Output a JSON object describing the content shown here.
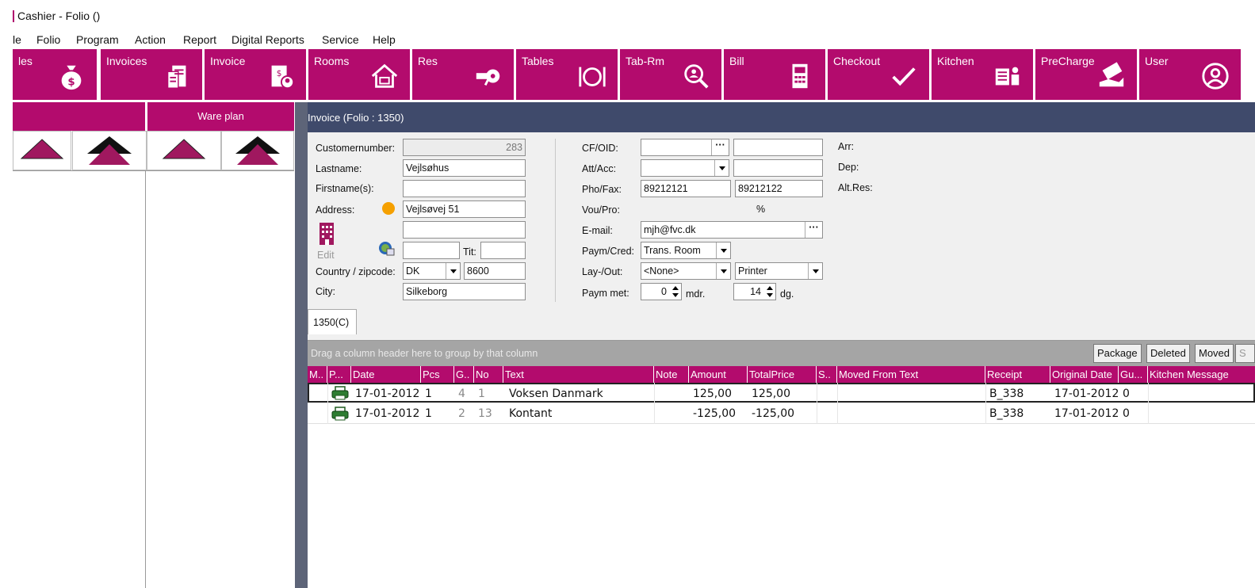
{
  "window": {
    "title": "Cashier - Folio ()"
  },
  "menu": [
    "le",
    "Folio",
    "Program",
    "Action",
    "Report",
    "Digital Reports",
    "Service",
    "Help"
  ],
  "toolbar": [
    {
      "label": "les",
      "icon": "money-bag-icon"
    },
    {
      "label": "Invoices",
      "icon": "invoices-icon"
    },
    {
      "label": "Invoice",
      "icon": "invoice-person-icon"
    },
    {
      "label": "Rooms",
      "icon": "rooms-icon"
    },
    {
      "label": "Res",
      "icon": "key-icon"
    },
    {
      "label": "Tables",
      "icon": "plate-cutlery-icon"
    },
    {
      "label": "Tab-Rm",
      "icon": "search-person-icon"
    },
    {
      "label": "Bill",
      "icon": "cash-register-icon"
    },
    {
      "label": "Checkout",
      "icon": "checkmark-icon"
    },
    {
      "label": "Kitchen",
      "icon": "kitchen-icon"
    },
    {
      "label": "PreCharge",
      "icon": "hand-money-icon"
    },
    {
      "label": "User",
      "icon": "user-icon"
    }
  ],
  "left_panel": {
    "header_left": "",
    "header_right": "Ware plan"
  },
  "invoice": {
    "header": "Invoice (Folio : 1350)",
    "labels": {
      "customernumber": "Customernumber:",
      "lastname": "Lastname:",
      "firstname": "Firstname(s):",
      "address": "Address:",
      "edit": "Edit",
      "tit": "Tit:",
      "country": "Country / zipcode:",
      "city": "City:",
      "cfoid": "CF/OID:",
      "attacc": "Att/Acc:",
      "phofax": "Pho/Fax:",
      "voupro": "Vou/Pro:",
      "email": "E-mail:",
      "paymcred": "Paym/Cred:",
      "layout": "Lay-/Out:",
      "paymmet": "Paym met:",
      "mdr": "mdr.",
      "dg": "dg.",
      "arr": "Arr:",
      "dep": "Dep:",
      "altres": "Alt.Res:",
      "percent": "%"
    },
    "values": {
      "customernumber": "283",
      "lastname": "Vejlsøhus",
      "firstname": "",
      "address": "Vejlsøvej 51",
      "address2": "",
      "extra": "",
      "tit": "",
      "country": "DK",
      "zipcode": "8600",
      "city": "Silkeborg",
      "cfoid": "",
      "cfoid2": "",
      "attacc": "",
      "attacc2": "",
      "phone": "89212121",
      "fax": "89212122",
      "email": "mjh@fvc.dk",
      "paymcred": "Trans. Room",
      "layout": "<None>",
      "out": "Printer",
      "paym_months": "0",
      "paym_days": "14"
    },
    "tab": "1350(C)"
  },
  "grid": {
    "group_hint": "Drag a column header here to group by that column",
    "buttons": [
      "Package",
      "Deleted",
      "Moved",
      "S"
    ],
    "columns": [
      "M..",
      "P...",
      "Date",
      "Pcs",
      "G..",
      "No",
      "Text",
      "Note",
      "Amount",
      "TotalPrice",
      "S..",
      "Moved From Text",
      "Receipt",
      "Original Date",
      "Gu...",
      "Kitchen Message"
    ],
    "rows": [
      {
        "date": "17-01-2012",
        "pcs": "1",
        "g": "4",
        "no": "1",
        "text": "Voksen Danmark",
        "note": "",
        "amount": "125,00",
        "total": "125,00",
        "s": "",
        "moved": "",
        "receipt": "B_338",
        "orig": "17-01-2012",
        "gu": "0",
        "kitchen": ""
      },
      {
        "date": "17-01-2012",
        "pcs": "1",
        "g": "2",
        "no": "13",
        "text": "Kontant",
        "note": "",
        "amount": "-125,00",
        "total": "-125,00",
        "s": "",
        "moved": "",
        "receipt": "B_338",
        "orig": "17-01-2012",
        "gu": "0",
        "kitchen": ""
      }
    ]
  },
  "colors": {
    "brand": "#b30b6d",
    "header_dark": "#3f4a6b",
    "accent_dot": "#f5a000"
  }
}
